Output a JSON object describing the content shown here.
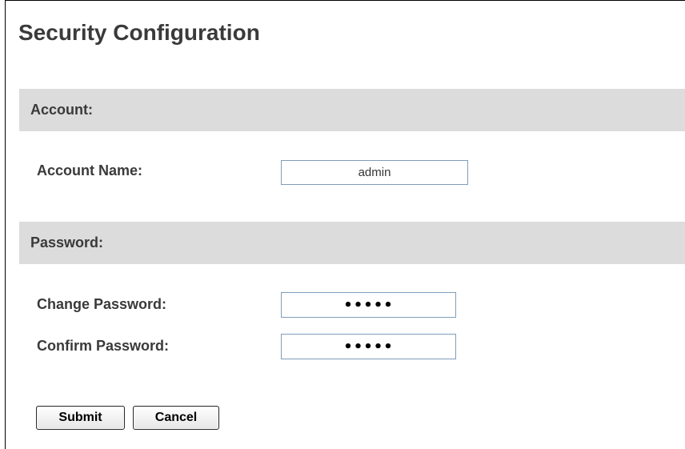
{
  "page": {
    "title": "Security Configuration"
  },
  "account_section": {
    "heading": "Account:",
    "account_name_label": "Account Name:",
    "account_name_value": "admin"
  },
  "password_section": {
    "heading": "Password:",
    "change_password_label": "Change Password:",
    "change_password_value": "•••••",
    "confirm_password_label": "Confirm Password:",
    "confirm_password_value": "•••••"
  },
  "actions": {
    "submit_label": "Submit",
    "cancel_label": "Cancel"
  },
  "colors": {
    "section_background": "#dcdcdc",
    "text": "#3a3a3a",
    "input_border": "#7f9db9"
  }
}
